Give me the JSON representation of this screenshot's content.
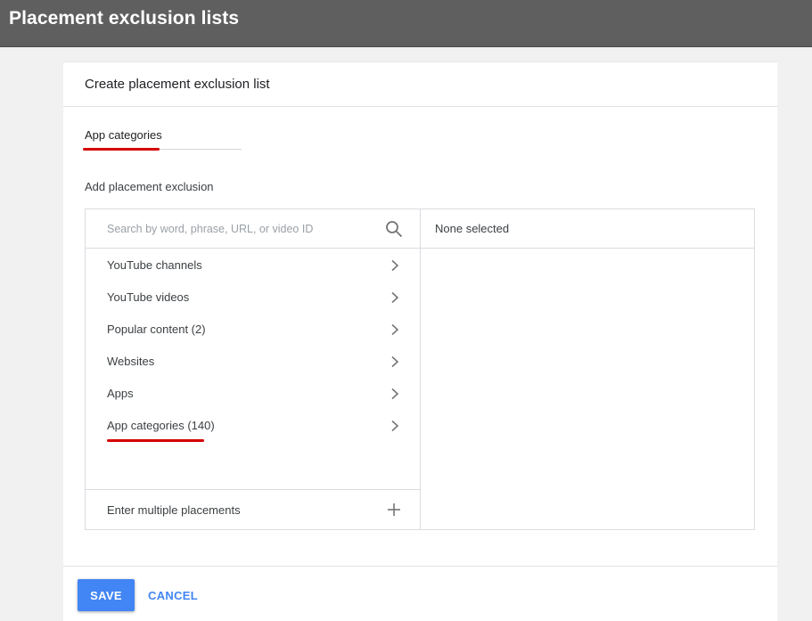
{
  "header": {
    "title": "Placement exclusion lists"
  },
  "card": {
    "title": "Create placement exclusion list",
    "name_value": "App categories",
    "section_label": "Add placement exclusion"
  },
  "search": {
    "placeholder": "Search by word, phrase, URL, or video ID",
    "icon": "search-icon"
  },
  "categories": [
    {
      "label": "YouTube channels",
      "icon": "chevron-right-icon"
    },
    {
      "label": "YouTube videos",
      "icon": "chevron-right-icon"
    },
    {
      "label": "Popular content (2)",
      "icon": "chevron-right-icon"
    },
    {
      "label": "Websites",
      "icon": "chevron-right-icon"
    },
    {
      "label": "Apps",
      "icon": "chevron-right-icon"
    },
    {
      "label": "App categories (140)",
      "icon": "chevron-right-icon"
    }
  ],
  "multi": {
    "label": "Enter multiple placements",
    "icon": "plus-icon"
  },
  "selection": {
    "status": "None selected"
  },
  "actions": {
    "save_label": "SAVE",
    "cancel_label": "CANCEL"
  },
  "colors": {
    "topbar": "#5f5f5f",
    "accent": "#4285f4",
    "highlight": "#d40000"
  }
}
